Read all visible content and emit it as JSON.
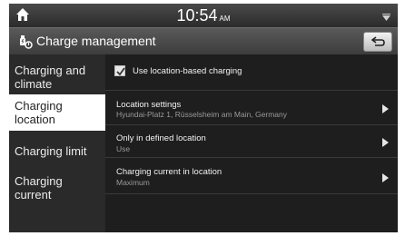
{
  "status": {
    "time": "10:54",
    "ampm": "AM"
  },
  "header": {
    "title": "Charge management"
  },
  "sidebar": {
    "items": [
      {
        "line1": "Charging and",
        "line2": "climate",
        "active": false
      },
      {
        "line1": "Charging",
        "line2": "location",
        "active": true
      },
      {
        "line1": "Charging limit",
        "line2": "",
        "active": false
      },
      {
        "line1": "Charging",
        "line2": "current",
        "active": false
      }
    ]
  },
  "options": {
    "use_location": {
      "label": "Use location-based charging",
      "checked": true
    },
    "location_settings": {
      "label": "Location settings",
      "value": "Hyundai-Platz 1, Rüsselsheim am Main, Germany"
    },
    "only_in_location": {
      "label": "Only in defined location",
      "value": "Use"
    },
    "charging_current": {
      "label": "Charging current in location",
      "value": "Maximum"
    }
  },
  "colors": {
    "active_tab": "#ffffff",
    "background": "#1e1e1e",
    "title_bar": "#4a4a4a"
  }
}
